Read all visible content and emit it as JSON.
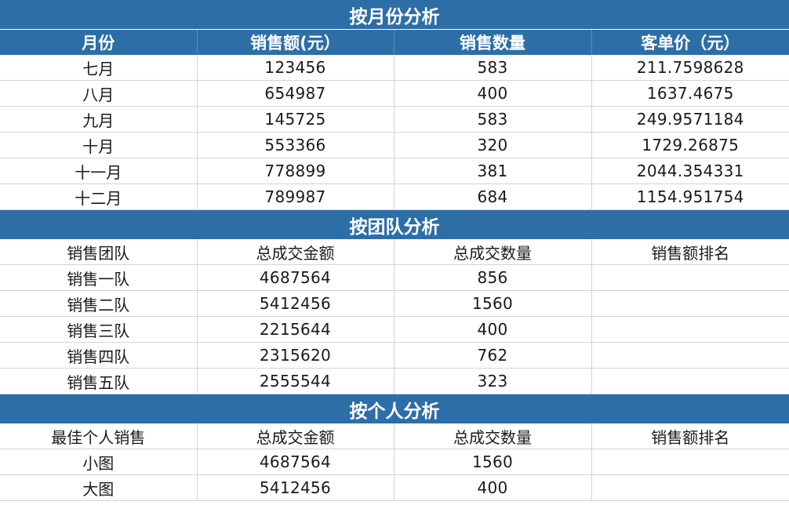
{
  "monthly": {
    "title": "按月份分析",
    "headers": [
      "月份",
      "销售额(元）",
      "销售数量",
      "客单价（元）"
    ],
    "rows": [
      [
        "七月",
        "123456",
        "583",
        "211.7598628"
      ],
      [
        "八月",
        "654987",
        "400",
        "1637.4675"
      ],
      [
        "九月",
        "145725",
        "583",
        "249.9571184"
      ],
      [
        "十月",
        "553366",
        "320",
        "1729.26875"
      ],
      [
        "十一月",
        "778899",
        "381",
        "2044.354331"
      ],
      [
        "十二月",
        "789987",
        "684",
        "1154.951754"
      ]
    ]
  },
  "team": {
    "title": "按团队分析",
    "headers": [
      "销售团队",
      "总成交金额",
      "总成交数量",
      "销售额排名"
    ],
    "rows": [
      [
        "销售一队",
        "4687564",
        "856",
        ""
      ],
      [
        "销售二队",
        "5412456",
        "1560",
        ""
      ],
      [
        "销售三队",
        "2215644",
        "400",
        ""
      ],
      [
        "销售四队",
        "2315620",
        "762",
        ""
      ],
      [
        "销售五队",
        "2555544",
        "323",
        ""
      ]
    ]
  },
  "personal": {
    "title": "按个人分析",
    "headers": [
      "最佳个人销售",
      "总成交金额",
      "总成交数量",
      "销售额排名"
    ],
    "rows": [
      [
        "小图",
        "4687564",
        "1560",
        ""
      ],
      [
        "大图",
        "5412456",
        "400",
        ""
      ]
    ]
  }
}
